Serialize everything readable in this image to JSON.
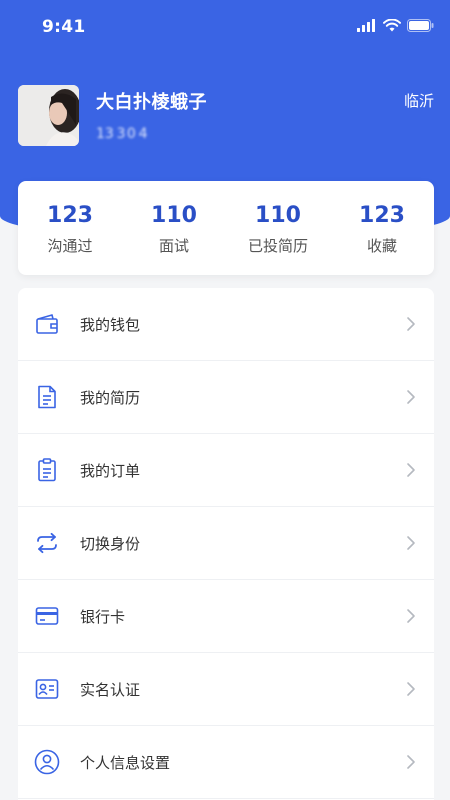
{
  "status_bar": {
    "time": "9:41"
  },
  "profile": {
    "name": "大白扑棱蛾子",
    "phone": "13  3 0  4  ",
    "city": "临沂"
  },
  "stats": [
    {
      "value": "123",
      "label": "沟通过"
    },
    {
      "value": "110",
      "label": "面试"
    },
    {
      "value": "110",
      "label": "已投简历"
    },
    {
      "value": "123",
      "label": "收藏"
    }
  ],
  "menu": [
    {
      "label": "我的钱包",
      "icon": "wallet-icon"
    },
    {
      "label": "我的简历",
      "icon": "resume-icon"
    },
    {
      "label": "我的订单",
      "icon": "order-icon"
    },
    {
      "label": "切换身份",
      "icon": "switch-icon"
    },
    {
      "label": "银行卡",
      "icon": "bank-card-icon"
    },
    {
      "label": "实名认证",
      "icon": "id-card-icon"
    },
    {
      "label": "个人信息设置",
      "icon": "user-icon"
    }
  ],
  "colors": {
    "brand": "#3a64e4",
    "stat_value": "#2a4fc6",
    "icon": "#3a64e4"
  }
}
